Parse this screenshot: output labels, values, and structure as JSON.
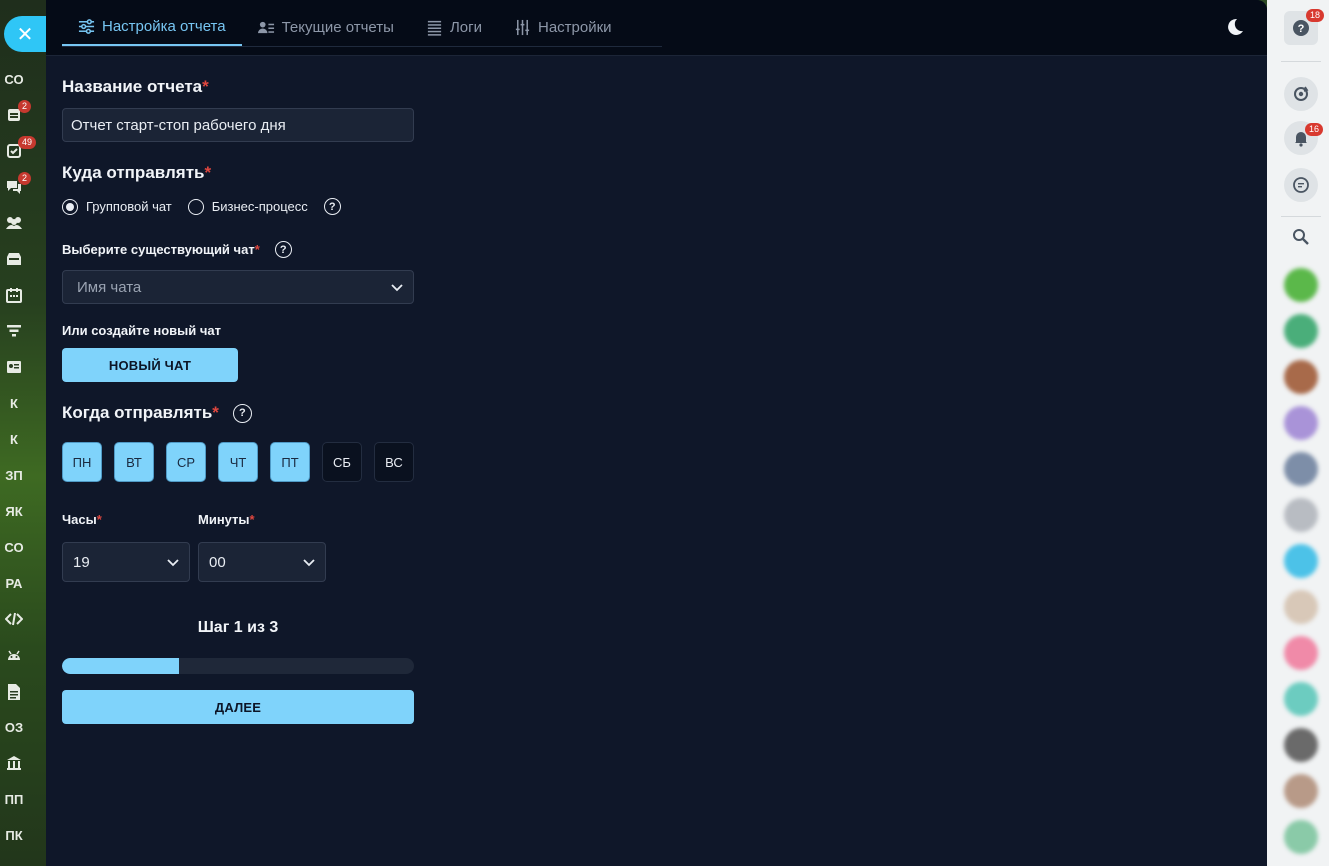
{
  "left_sidebar": {
    "close_label": "✕",
    "items": [
      {
        "type": "text",
        "label": "СО"
      },
      {
        "type": "icon",
        "icon": "calendar-card-icon",
        "badge": "2"
      },
      {
        "type": "icon",
        "icon": "task-check-icon",
        "badge": "49"
      },
      {
        "type": "icon",
        "icon": "chat-bubbles-icon",
        "badge": "2"
      },
      {
        "type": "icon",
        "icon": "users-group-icon"
      },
      {
        "type": "icon",
        "icon": "inbox-icon"
      },
      {
        "type": "icon",
        "icon": "calendar-icon"
      },
      {
        "type": "icon",
        "icon": "funnel-icon"
      },
      {
        "type": "icon",
        "icon": "contact-card-icon"
      },
      {
        "type": "text",
        "label": "К"
      },
      {
        "type": "text",
        "label": "К"
      },
      {
        "type": "text",
        "label": "ЗП"
      },
      {
        "type": "text",
        "label": "ЯК"
      },
      {
        "type": "text",
        "label": "СО"
      },
      {
        "type": "text",
        "label": "РА"
      },
      {
        "type": "icon",
        "icon": "code-icon"
      },
      {
        "type": "icon",
        "icon": "android-icon"
      },
      {
        "type": "icon",
        "icon": "document-icon"
      },
      {
        "type": "text",
        "label": "ОЗ"
      },
      {
        "type": "icon",
        "icon": "bank-icon"
      },
      {
        "type": "text",
        "label": "ПП"
      },
      {
        "type": "text",
        "label": "ПК"
      }
    ]
  },
  "tabs": [
    {
      "label": "Настройка отчета",
      "icon": "sliders-icon",
      "active": true
    },
    {
      "label": "Текущие отчеты",
      "icon": "user-list-icon",
      "active": false
    },
    {
      "label": "Логи",
      "icon": "log-lines-icon",
      "active": false
    },
    {
      "label": "Настройки",
      "icon": "settings-sliders-icon",
      "active": false
    }
  ],
  "form": {
    "report_name_label": "Название отчета",
    "required_mark": "*",
    "report_name_value": "Отчет старт-стоп рабочего дня",
    "where_label": "Куда отправлять",
    "radio_group_chat": "Групповой чат",
    "radio_business_process": "Бизнес-процесс",
    "selected_radio": "group_chat",
    "choose_chat_label": "Выберите существующий чат",
    "chat_placeholder": "Имя чата",
    "or_create_label": "Или создайте новый чат",
    "new_chat_button": "НОВЫЙ ЧАТ",
    "when_label": "Когда отправлять",
    "days": [
      {
        "label": "ПН",
        "selected": true
      },
      {
        "label": "ВТ",
        "selected": true
      },
      {
        "label": "СР",
        "selected": true
      },
      {
        "label": "ЧТ",
        "selected": true
      },
      {
        "label": "ПТ",
        "selected": true
      },
      {
        "label": "СБ",
        "selected": false
      },
      {
        "label": "ВС",
        "selected": false
      }
    ],
    "hours_label": "Часы",
    "hours_value": "19",
    "minutes_label": "Минуты",
    "minutes_value": "00",
    "step_text": "Шаг 1 из 3",
    "progress_fraction": 0.333,
    "next_button": "ДАЛЕЕ"
  },
  "right_sidebar": {
    "help_badge": "18",
    "notifications_badge": "16",
    "icons": [
      "help-icon",
      "sync-icon",
      "bell-icon",
      "chat-search-icon",
      "search-icon"
    ]
  },
  "colors": {
    "accent": "#7fd3fb",
    "tab_active": "#77c6f3",
    "required": "#e0473f",
    "panel_bg": "#0f1729",
    "badge": "#c6392f"
  }
}
